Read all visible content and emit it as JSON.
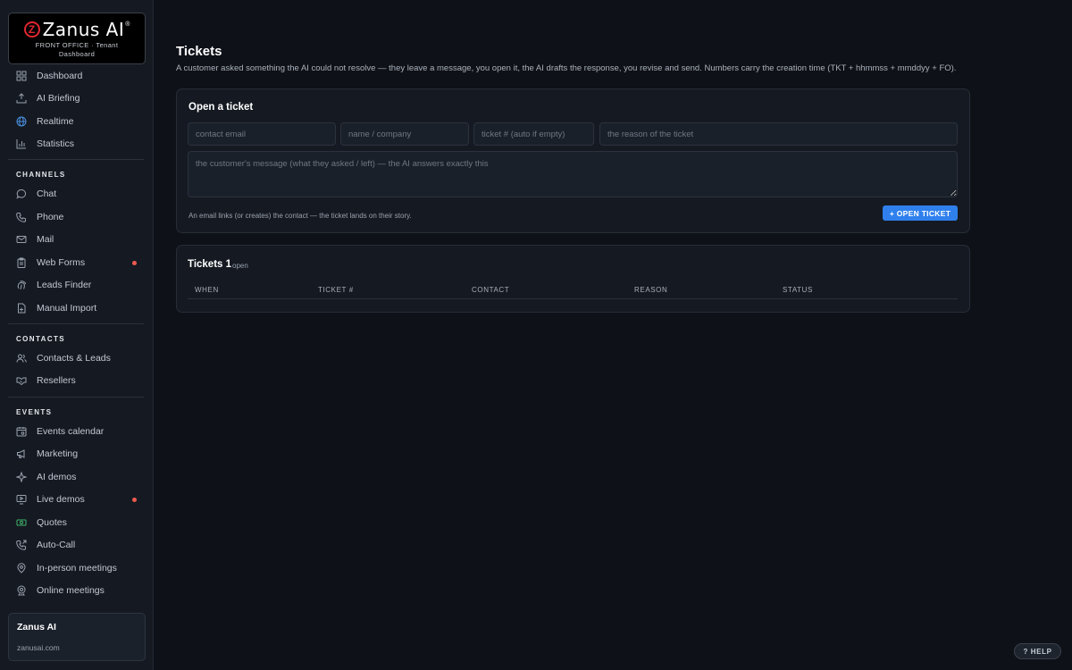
{
  "brand": {
    "logo_letter": "Z",
    "name": "Zanus AI",
    "registered": "®",
    "subtitle_line1": "FRONT OFFICE · Tenant",
    "subtitle_line2": "Dashboard"
  },
  "sidebar": {
    "top_items": [
      {
        "label": "Dashboard",
        "icon": "grid-icon"
      },
      {
        "label": "AI Briefing",
        "icon": "upload-icon"
      },
      {
        "label": "Realtime",
        "icon": "globe-icon"
      },
      {
        "label": "Statistics",
        "icon": "bar-chart-icon"
      }
    ],
    "sections": [
      {
        "title": "CHANNELS",
        "items": [
          {
            "label": "Chat",
            "icon": "chat-bubble-icon",
            "dot": false
          },
          {
            "label": "Phone",
            "icon": "phone-icon",
            "dot": false
          },
          {
            "label": "Mail",
            "icon": "mail-icon",
            "dot": false
          },
          {
            "label": "Web Forms",
            "icon": "clipboard-icon",
            "dot": true
          },
          {
            "label": "Leads Finder",
            "icon": "fingerprint-icon",
            "dot": false
          },
          {
            "label": "Manual Import",
            "icon": "file-plus-icon",
            "dot": false
          }
        ]
      },
      {
        "title": "CONTACTS",
        "items": [
          {
            "label": "Contacts & Leads",
            "icon": "users-icon",
            "dot": false
          },
          {
            "label": "Resellers",
            "icon": "handshake-icon",
            "dot": false
          }
        ]
      },
      {
        "title": "EVENTS",
        "items": [
          {
            "label": "Events calendar",
            "icon": "calendar-icon",
            "dot": false
          },
          {
            "label": "Marketing",
            "icon": "megaphone-icon",
            "dot": false
          },
          {
            "label": "AI demos",
            "icon": "sparkle-icon",
            "dot": false
          },
          {
            "label": "Live demos",
            "icon": "monitor-play-icon",
            "dot": true
          },
          {
            "label": "Quotes",
            "icon": "money-icon",
            "dot": false
          },
          {
            "label": "Auto-Call",
            "icon": "phone-forward-icon",
            "dot": false
          },
          {
            "label": "In-person meetings",
            "icon": "map-pin-icon",
            "dot": false
          },
          {
            "label": "Online meetings",
            "icon": "webcam-icon",
            "dot": false
          }
        ]
      }
    ],
    "footer": {
      "title": "Zanus AI",
      "url": "zanusai.com"
    }
  },
  "main": {
    "title": "Tickets",
    "description": "A customer asked something the AI could not resolve — they leave a message, you open it, the AI drafts the response, you revise and send. Numbers carry the creation time (TKT + hhmmss + mmddyy + FO).",
    "open_ticket": {
      "title": "Open a ticket",
      "email_placeholder": "contact email",
      "name_placeholder": "name / company",
      "ticket_placeholder": "ticket # (auto if empty)",
      "reason_placeholder": "the reason of the ticket",
      "message_placeholder": "the customer's message (what they asked / left) — the AI answers exactly this",
      "hint": "An email links (or creates) the contact — the ticket lands on their story.",
      "button_label": "+ OPEN TICKET"
    },
    "tickets": {
      "title": "Tickets 1",
      "subtitle": "open",
      "columns": [
        "WHEN",
        "TICKET #",
        "CONTACT",
        "REASON",
        "STATUS"
      ],
      "rows": []
    }
  },
  "help_label": "? HELP",
  "colors": {
    "accent": "#2f80ed",
    "brand_red": "#e0262e",
    "notification_dot": "#f05a4f",
    "background": "#0e1117",
    "sidebar": "#151a22"
  }
}
